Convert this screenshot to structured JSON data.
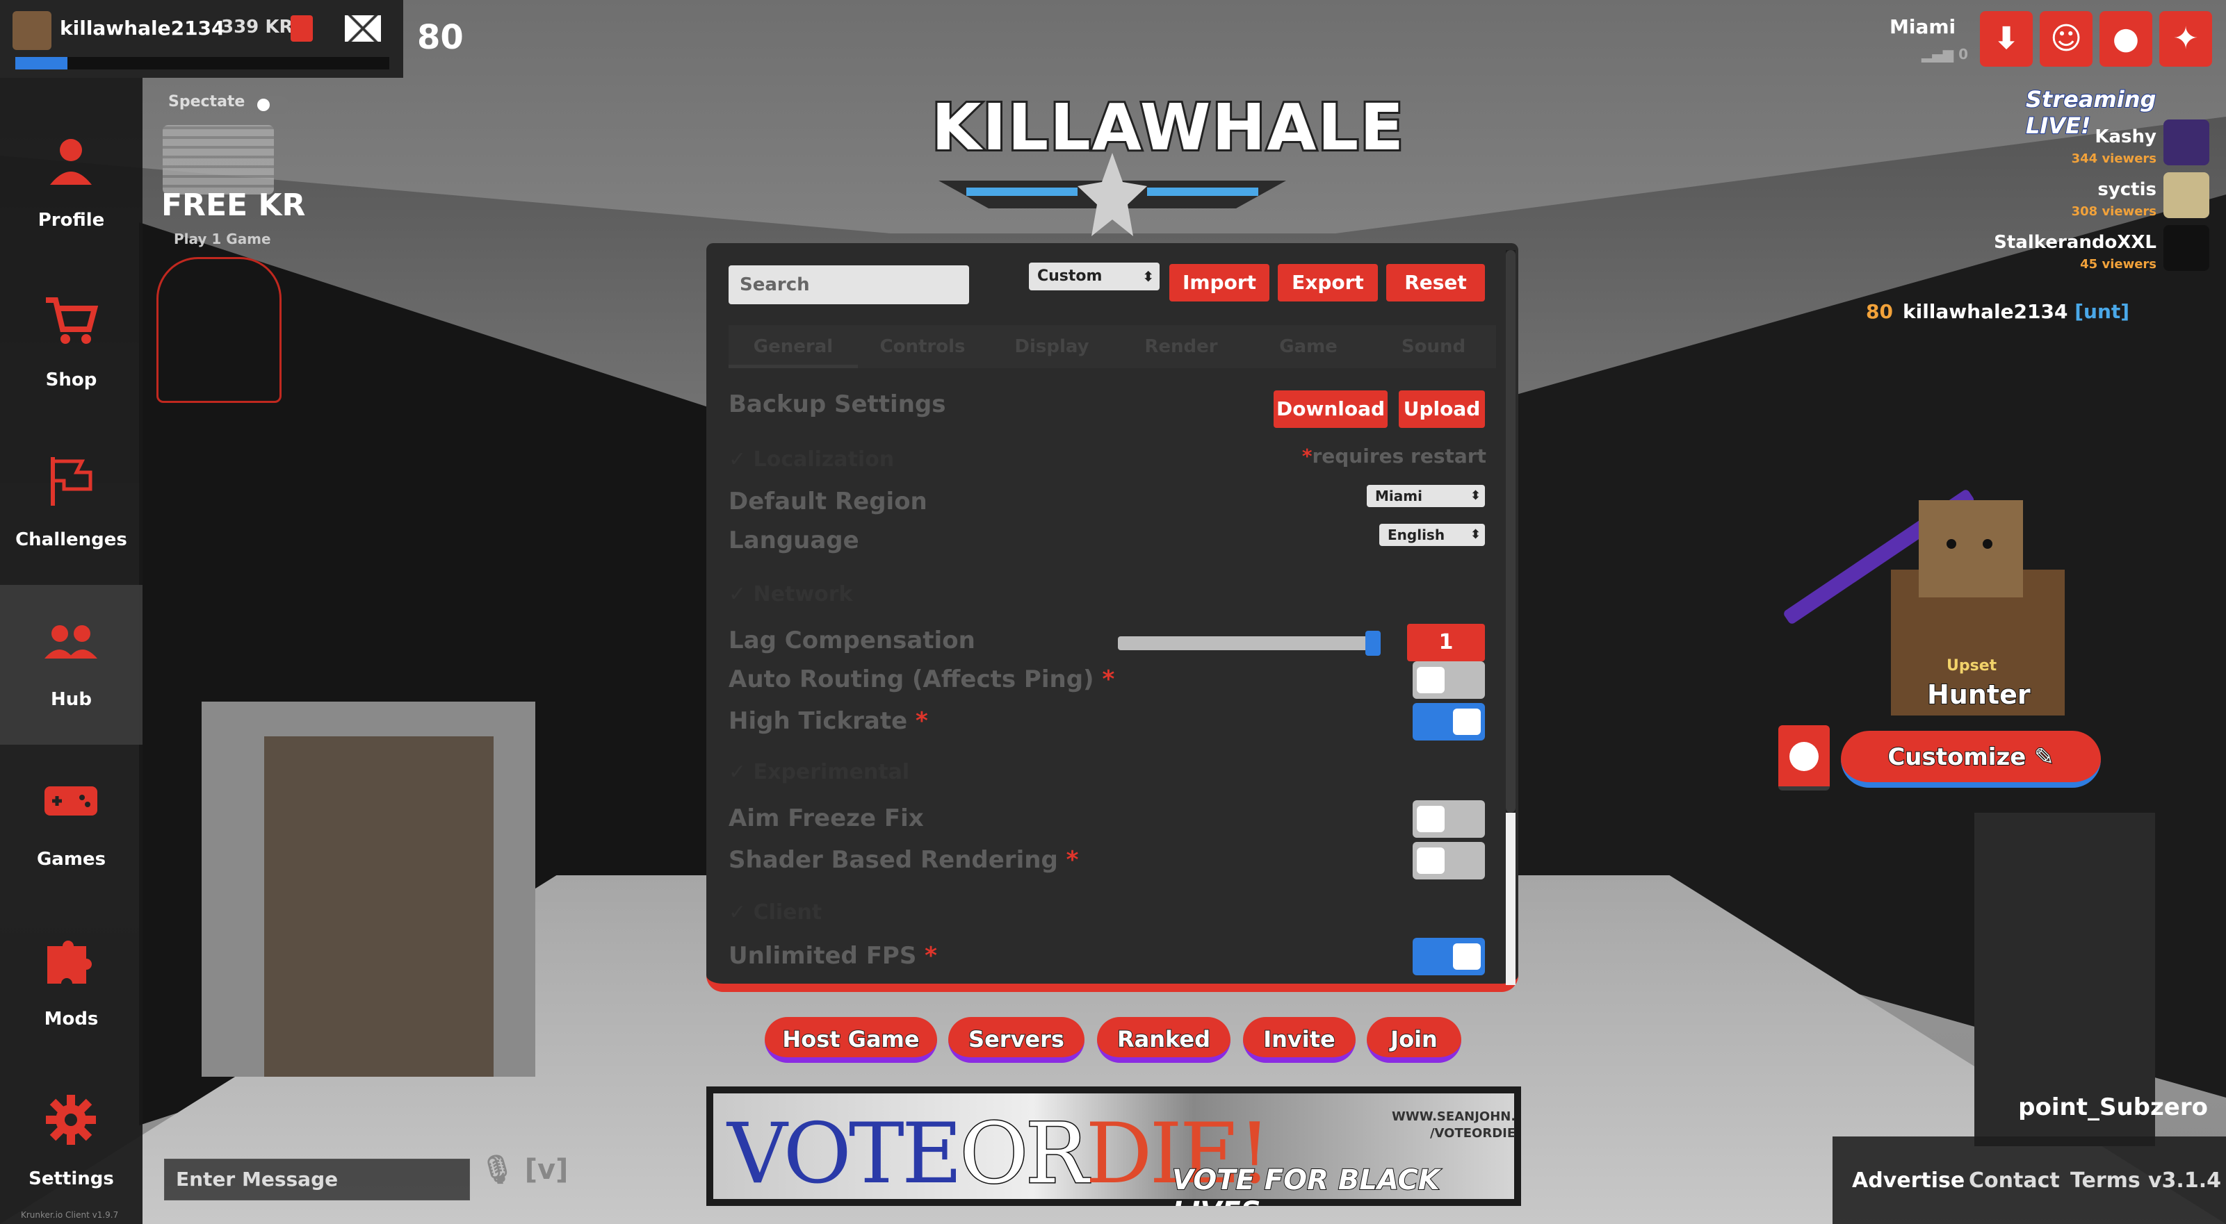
{
  "player": {
    "name": "killawhale2134",
    "kr": "339 KR",
    "level": "80",
    "xp_fraction": 0.14
  },
  "sidebar": {
    "items": [
      {
        "label": "Profile",
        "icon": "person-icon"
      },
      {
        "label": "Shop",
        "icon": "cart-icon"
      },
      {
        "label": "Challenges",
        "icon": "flag-icon"
      },
      {
        "label": "Hub",
        "icon": "people-icon"
      },
      {
        "label": "Games",
        "icon": "gamepad-icon"
      },
      {
        "label": "Mods",
        "icon": "puzzle-icon"
      },
      {
        "label": "Settings",
        "icon": "gear-icon"
      }
    ]
  },
  "spectate": {
    "label": "Spectate",
    "on": false
  },
  "promo": {
    "title": "FREE KR",
    "subtitle": "Play 1 Game"
  },
  "logo": {
    "text": "KILLAWHALE"
  },
  "settings": {
    "search_placeholder": "Search",
    "preset": "Custom",
    "import_label": "Import",
    "export_label": "Export",
    "reset_label": "Reset",
    "tabs": [
      "General",
      "Controls",
      "Display",
      "Render",
      "Game",
      "Sound"
    ],
    "backup": {
      "label": "Backup Settings",
      "download": "Download",
      "upload": "Upload"
    },
    "section_localization": "Localization",
    "requires_restart": "requires restart",
    "default_region": {
      "label": "Default Region",
      "value": "Miami"
    },
    "language": {
      "label": "Language",
      "value": "English"
    },
    "section_network": "Network",
    "lag_compensation": {
      "label": "Lag Compensation",
      "value": "1",
      "fraction": 1.0
    },
    "auto_routing": {
      "label": "Auto Routing (Affects Ping)",
      "on": false
    },
    "high_tickrate": {
      "label": "High Tickrate",
      "on": true
    },
    "section_experimental": "Experimental",
    "aim_freeze": {
      "label": "Aim Freeze Fix",
      "on": false
    },
    "shader_rendering": {
      "label": "Shader Based Rendering",
      "on": false
    },
    "section_client": "Client",
    "unlimited_fps": {
      "label": "Unlimited FPS",
      "on": true
    }
  },
  "game_buttons": [
    "Host Game",
    "Servers",
    "Ranked",
    "Invite",
    "Join"
  ],
  "ad": {
    "vote": "VOTE",
    "or": "OR",
    "die": "DIE!",
    "sub": "VOTE FOR BLACK LIVES.",
    "url1": "WWW.SEANJOHN.",
    "url2": "/VOTEORDIE"
  },
  "chat": {
    "placeholder": "Enter Message",
    "voice_key": "[v]"
  },
  "client_version": "Krunker.io Client v1.9.7",
  "server": {
    "region": "Miami",
    "ping": "0"
  },
  "streaming": {
    "title": "Streaming LIVE!",
    "streamers": [
      {
        "name": "Kashy",
        "viewers": "344 viewers"
      },
      {
        "name": "syctis",
        "viewers": "308 viewers"
      },
      {
        "name": "StalkerandoXXL",
        "viewers": "45 viewers"
      }
    ]
  },
  "leaderboard": {
    "level": "80",
    "name": "killawhale2134",
    "clan": "[unt]"
  },
  "character": {
    "mood": "Upset",
    "class": "Hunter",
    "customize_label": "Customize"
  },
  "map_name": "point_Subzero",
  "footer": {
    "advertise": "Advertise",
    "contact": "Contact",
    "terms": "Terms",
    "version": "v3.1.4"
  },
  "colors": {
    "accent": "#e0352b",
    "blue": "#2f7de1",
    "panel": "#2b2b2b"
  }
}
